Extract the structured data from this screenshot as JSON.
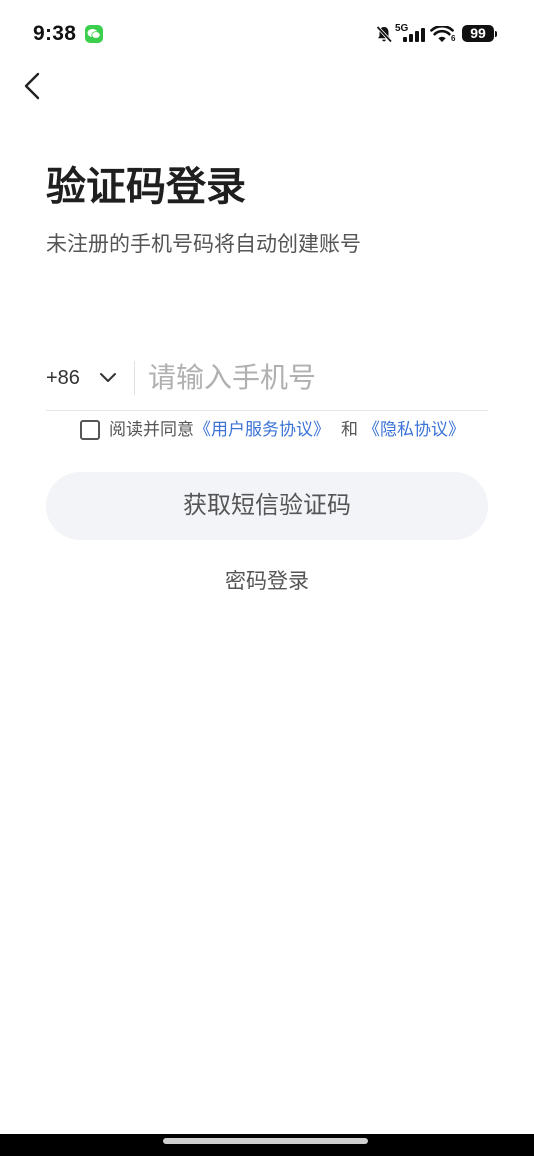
{
  "status_bar": {
    "time": "9:38",
    "network": "5G",
    "wifi_badge": "6",
    "battery": "99",
    "icons": [
      "wechat-notification-icon",
      "bell-mute-icon",
      "signal-bars-icon",
      "wifi-icon",
      "battery-icon"
    ]
  },
  "header": {
    "back_icon": "chevron-left-icon"
  },
  "login": {
    "title": "验证码登录",
    "subtitle": "未注册的手机号码将自动创建账号"
  },
  "phone": {
    "country_code": "+86",
    "country_icon": "chevron-down-icon",
    "placeholder": "请输入手机号",
    "value": ""
  },
  "agreement": {
    "checked": false,
    "prefix": "阅读并同意",
    "terms": "《用户服务协议》",
    "and": "和",
    "privacy": "《隐私协议》"
  },
  "actions": {
    "get_code": "获取短信验证码",
    "password_login": "密码登录"
  },
  "colors": {
    "accent": "#3b73d6",
    "button_bg": "#f3f4f8",
    "text_primary": "#1f1f1f",
    "text_secondary": "#555555",
    "placeholder": "#b0b0b0",
    "app_icon_green": "#3ccf4e"
  }
}
